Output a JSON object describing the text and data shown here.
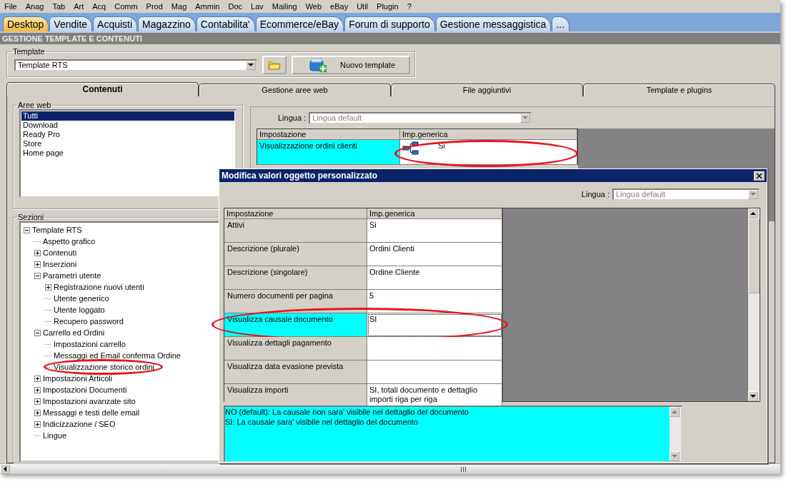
{
  "menu": [
    "File",
    "Anag",
    "Tab",
    "Art",
    "Acq",
    "Comm",
    "Prod",
    "Mag",
    "Ammin",
    "Doc",
    "Lav",
    "Mailing",
    "Web",
    "eBay",
    "Util",
    "Plugin",
    "?"
  ],
  "nav_tabs": [
    {
      "label": "Desktop",
      "selected": true
    },
    {
      "label": "Vendite",
      "selected": false
    },
    {
      "label": "Acquisti",
      "selected": false
    },
    {
      "label": "Magazzino",
      "selected": false
    },
    {
      "label": "Contabilita'",
      "selected": false
    },
    {
      "label": "Ecommerce/eBay",
      "selected": false
    },
    {
      "label": "Forum di supporto",
      "selected": false
    },
    {
      "label": "Gestione messaggistica",
      "selected": false
    },
    {
      "label": "...",
      "selected": false
    }
  ],
  "section_title": "GESTIONE TEMPLATE E CONTENUTI",
  "template": {
    "label": "Template",
    "value": "Template RTS",
    "new_button": "Nuovo template"
  },
  "content_tabs": [
    {
      "label": "Contenuti",
      "selected": true
    },
    {
      "label": "Gestione aree web",
      "selected": false
    },
    {
      "label": "File aggiuntivi",
      "selected": false
    },
    {
      "label": "Template e plugins",
      "selected": false
    }
  ],
  "aree_web": {
    "label": "Aree web",
    "items": [
      {
        "label": "Tutti",
        "selected": true
      },
      {
        "label": "Download",
        "selected": false
      },
      {
        "label": "Ready Pro",
        "selected": false
      },
      {
        "label": "Store",
        "selected": false
      },
      {
        "label": "Home page",
        "selected": false
      }
    ]
  },
  "sezioni": {
    "label": "Sezioni",
    "tree": [
      {
        "label": "Template RTS",
        "kind": "group",
        "expanded": true,
        "circled": false,
        "children": [
          {
            "label": "Aspetto grafico",
            "kind": "leaf",
            "circled": false
          },
          {
            "label": "Contenuti",
            "kind": "group",
            "expanded": false,
            "circled": false
          },
          {
            "label": "Inserzioni",
            "kind": "group",
            "expanded": false,
            "circled": false
          },
          {
            "label": "Parametri utente",
            "kind": "group",
            "expanded": true,
            "circled": false,
            "children": [
              {
                "label": "Registrazione nuovi utenti",
                "kind": "group",
                "expanded": false,
                "circled": false
              },
              {
                "label": "Utente generico",
                "kind": "leaf",
                "circled": false
              },
              {
                "label": "Utente loggato",
                "kind": "leaf",
                "circled": false
              },
              {
                "label": "Recupero password",
                "kind": "leaf",
                "circled": false
              }
            ]
          },
          {
            "label": "Carrello ed Ordini",
            "kind": "group",
            "expanded": true,
            "circled": false,
            "children": [
              {
                "label": "Impostazioni carrello",
                "kind": "leaf",
                "circled": false
              },
              {
                "label": "Messaggi ed Email conferma Ordine",
                "kind": "leaf",
                "circled": false
              },
              {
                "label": "Visualizzazione storico ordini",
                "kind": "leaf",
                "circled": true
              }
            ]
          },
          {
            "label": "Impostazioni Articoli",
            "kind": "group",
            "expanded": false,
            "circled": false
          },
          {
            "label": "Impostazioni Documenti",
            "kind": "group",
            "expanded": false,
            "circled": false
          },
          {
            "label": "Impostazioni avanzate sito",
            "kind": "group",
            "expanded": false,
            "circled": false
          },
          {
            "label": "Messaggi e testi delle email",
            "kind": "group",
            "expanded": false,
            "circled": false
          },
          {
            "label": "Indicizzazione / SEO",
            "kind": "group",
            "expanded": false,
            "circled": false
          },
          {
            "label": "Lingue",
            "kind": "leaf",
            "circled": false
          }
        ]
      }
    ]
  },
  "main_panel": {
    "lingua_label": "Lingua :",
    "lingua_value": "Lingua default",
    "columns": [
      "Impostazione",
      "Imp.generica"
    ],
    "rows": [
      {
        "setting": "Visualizzazione ordini clienti",
        "value": "Si",
        "selected": true,
        "circled": true
      }
    ]
  },
  "dialog": {
    "title": "Modifica valori oggetto personalizzato",
    "lingua_label": "Lingua :",
    "lingua_value": "Lingua default",
    "columns": [
      "Impostazione",
      "Imp.generica"
    ],
    "rows": [
      {
        "setting": "Attivi",
        "value": "Si",
        "selected": false,
        "circled": false
      },
      {
        "setting": "Descrizione (plurale)",
        "value": "Ordini Clienti",
        "selected": false,
        "circled": false
      },
      {
        "setting": "Descrizione (singolare)",
        "value": "Ordine Cliente",
        "selected": false,
        "circled": false
      },
      {
        "setting": "Numero documenti per pagina",
        "value": "5",
        "selected": false,
        "circled": false
      },
      {
        "setting": "Visualizza causale documento",
        "value": "SI",
        "selected": true,
        "circled": true
      },
      {
        "setting": "Visualizza dettagli pagamento",
        "value": "",
        "selected": false,
        "circled": false
      },
      {
        "setting": "Visualizza data evasione prevista",
        "value": "",
        "selected": false,
        "circled": false
      },
      {
        "setting": "Visualizza importi",
        "value": "SI, totali documento e dettaglio importi riga per riga",
        "selected": false,
        "circled": false
      }
    ],
    "description": [
      "NO (default): La causale non sara' visibile nel dettaglio del documento",
      "SI: La causale sara' visibile nel dettaglio del documento"
    ]
  }
}
